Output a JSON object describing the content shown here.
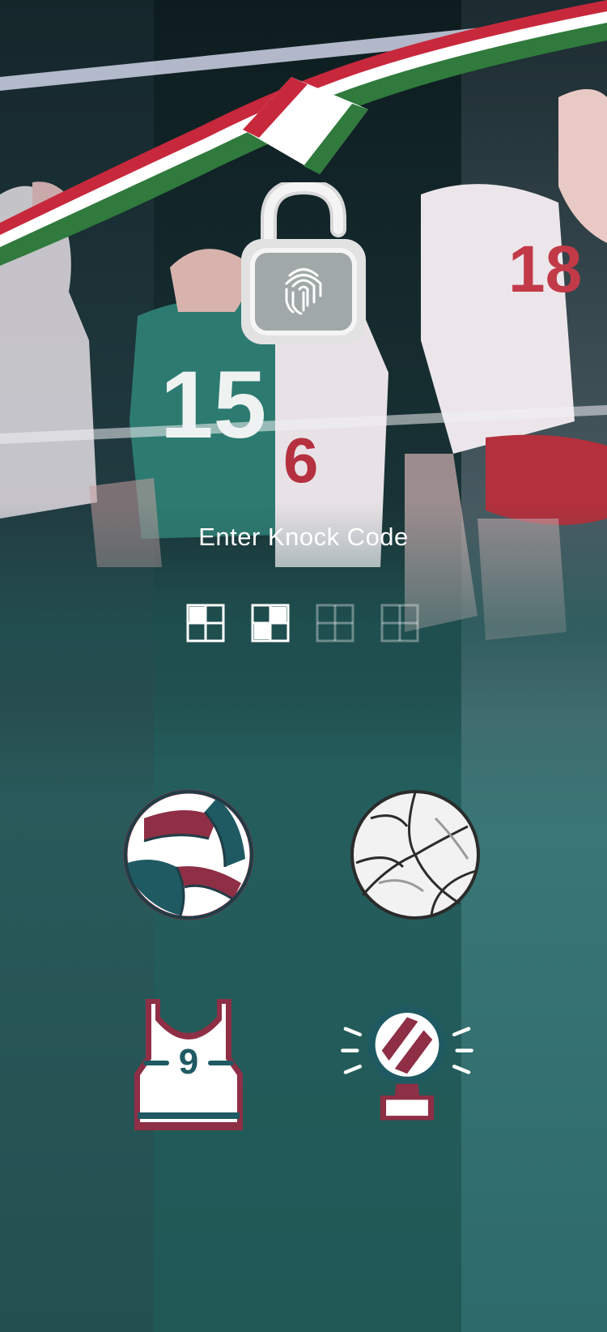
{
  "lockscreen": {
    "prompt": "Enter Knock Code",
    "entered_count": 2,
    "code_length": 4
  },
  "pad": {
    "tiles": [
      {
        "icon": "volleyball-maroon-teal-icon"
      },
      {
        "icon": "volleyball-white-icon"
      },
      {
        "icon": "jersey-number-9-icon",
        "label": "9"
      },
      {
        "icon": "volleyball-trophy-icon"
      }
    ]
  },
  "background": {
    "jersey_numbers": [
      "15",
      "6",
      "18"
    ],
    "colors": {
      "flag_red": "#c8283c",
      "flag_white": "#ffffff",
      "flag_green": "#2f7a3c",
      "teal": "#205856",
      "maroon": "#8e2f45"
    }
  }
}
